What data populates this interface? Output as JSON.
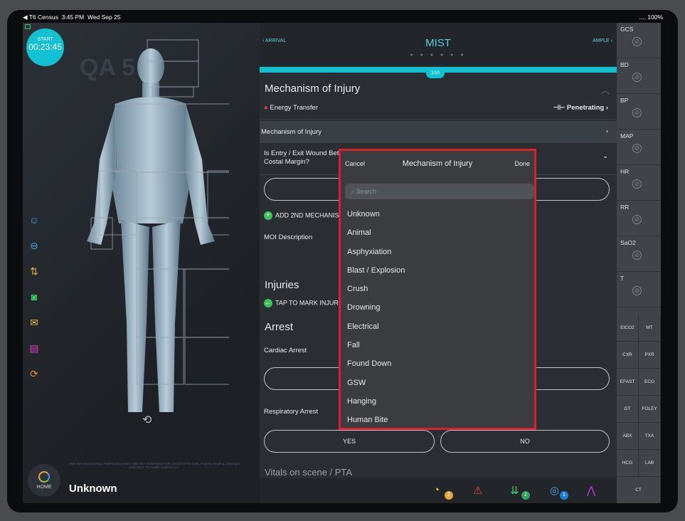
{
  "status": {
    "left": "◀ T6 Census  3:45 PM  Wed Sep 25",
    "right": "....  100%"
  },
  "left": {
    "timer_label": "START",
    "timer_value": "00:23:45",
    "qa": "QA 5",
    "disclaimer": "FOR INFORMATIONAL PURPOSES ONLY AND NOT INTENDED FOR DIAGNOSTIC USE. Patents Pending. Copyright 2016-2019. T6 Health Systems LLC.",
    "home_label": "HOME",
    "patient": "Unknown"
  },
  "nav": {
    "back": "ARRIVAL",
    "title": "MIST",
    "forward": "AMPLE",
    "progress_label": "1/10"
  },
  "sections": {
    "moi_title": "Mechanism of Injury",
    "energy_label": "Energy Transfer",
    "energy_value": "Penetrating",
    "moi_row": "Mechanism of Injury",
    "wound_q": "Is Entry / Exit Wound Between Clavicle and Costal Margin?",
    "add_moi": "ADD 2ND MECHANISM",
    "moi_desc": "MOI Description",
    "injuries_title": "Injuries",
    "tap_mark": "TAP TO MARK INJURIES",
    "arrest_title": "Arrest",
    "cardiac": "Cardiac Arrest",
    "resp": "Respiratory Arrest",
    "yes": "YES",
    "no": "NO",
    "vitals_scene": "Vitals on scene / PTA"
  },
  "vitals": {
    "items": [
      "GCS",
      "BD",
      "BP",
      "MAP",
      "HR",
      "RR",
      "SaO2",
      "T"
    ],
    "grid": [
      "EtCO2",
      "MT",
      "CXR",
      "PXR",
      "EFAST",
      "ECG",
      "GT",
      "FOLEY",
      "ABX",
      "TXA",
      "HCG",
      "LAB"
    ],
    "ct": "CT"
  },
  "bottom": {
    "badge1": "2",
    "badge2": "2",
    "badge3": "1"
  },
  "picker": {
    "cancel": "Cancel",
    "title": "Mechanism of Injury",
    "done": "Done",
    "search_placeholder": "Search",
    "options": [
      "Unknown",
      "Animal",
      "Asphyxiation",
      "Blast / Explosion",
      "Crush",
      "Drowning",
      "Electrical",
      "Fall",
      "Found Down",
      "GSW",
      "Hanging",
      "Human Bite"
    ]
  },
  "colors": {
    "accent": "#12c1d2",
    "highlight_border": "#d9202c"
  }
}
